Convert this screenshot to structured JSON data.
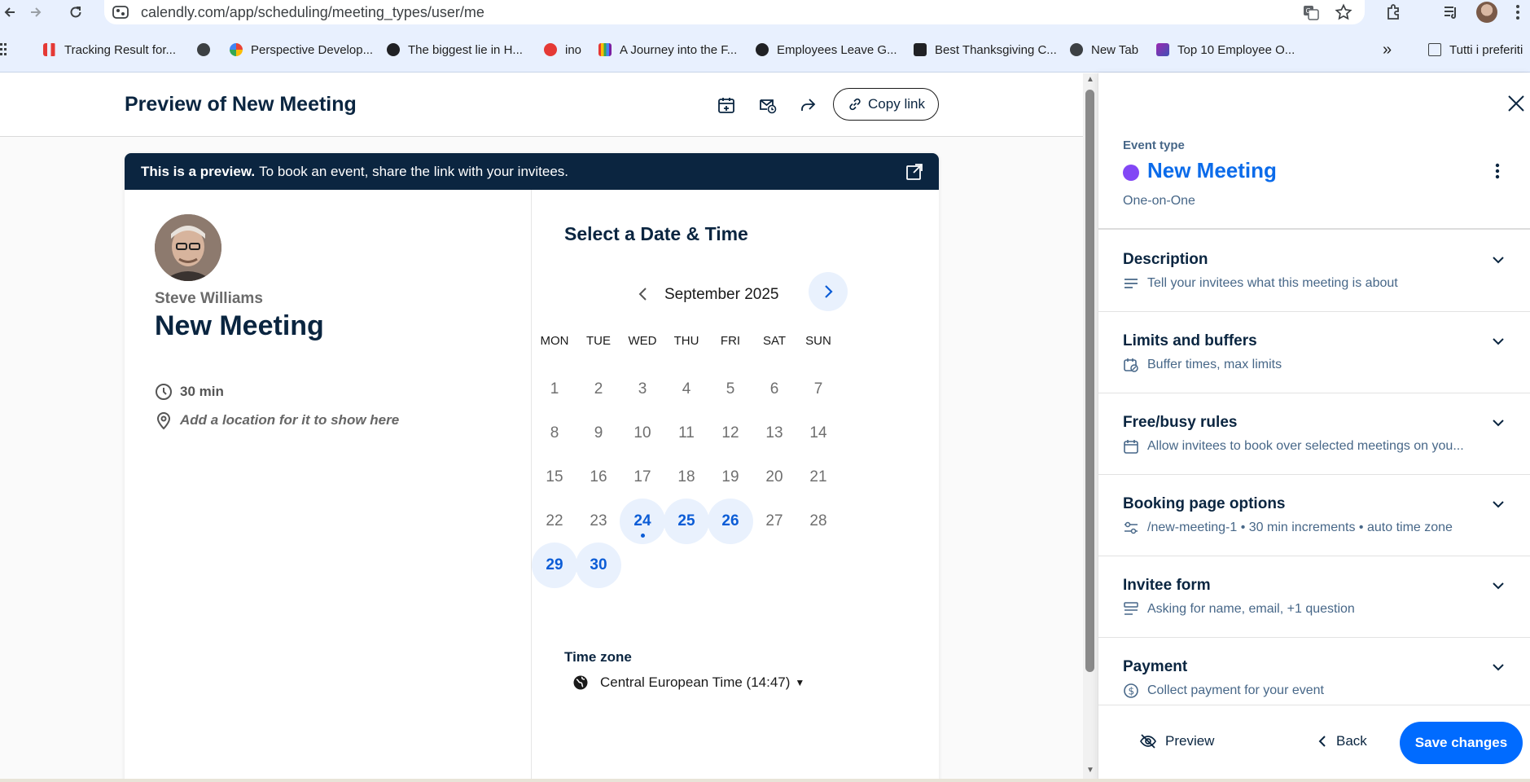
{
  "browser": {
    "url": "calendly.com/app/scheduling/meeting_types/user/me",
    "bookmarks": [
      {
        "label": "Tracking Result for...",
        "color": "#e53935"
      },
      {
        "label": "",
        "color": "#202124"
      },
      {
        "label": "Perspective Develop...",
        "color": "#4285f4"
      },
      {
        "label": "The biggest lie in H...",
        "color": "#202124"
      },
      {
        "label": "ino",
        "color": "#e53935"
      },
      {
        "label": "A Journey into the F...",
        "color": "#7b1fa2"
      },
      {
        "label": "Employees Leave G...",
        "color": "#202124"
      },
      {
        "label": "Best Thanksgiving C...",
        "color": "#202124"
      },
      {
        "label": "New Tab",
        "color": "#202124"
      },
      {
        "label": "Top 10 Employee O...",
        "color": "#9c27b0"
      }
    ],
    "overflow": "»",
    "all_bookmarks": "Tutti i preferiti"
  },
  "header": {
    "title": "Preview of New Meeting",
    "copy_link": "Copy link"
  },
  "preview": {
    "banner_bold": "This is a preview.",
    "banner_text": "To book an event, share the link with your invitees.",
    "host_name": "Steve Williams",
    "event_name": "New Meeting",
    "duration": "30 min",
    "location": "Add a location for it to show here",
    "calendar_title": "Select a Date & Time",
    "month": "September 2025",
    "weekdays": [
      "MON",
      "TUE",
      "WED",
      "THU",
      "FRI",
      "SAT",
      "SUN"
    ],
    "days": [
      {
        "n": "1"
      },
      {
        "n": "2"
      },
      {
        "n": "3"
      },
      {
        "n": "4"
      },
      {
        "n": "5"
      },
      {
        "n": "6"
      },
      {
        "n": "7"
      },
      {
        "n": "8"
      },
      {
        "n": "9"
      },
      {
        "n": "10"
      },
      {
        "n": "11"
      },
      {
        "n": "12"
      },
      {
        "n": "13"
      },
      {
        "n": "14"
      },
      {
        "n": "15"
      },
      {
        "n": "16"
      },
      {
        "n": "17"
      },
      {
        "n": "18"
      },
      {
        "n": "19"
      },
      {
        "n": "20"
      },
      {
        "n": "21"
      },
      {
        "n": "22"
      },
      {
        "n": "23"
      },
      {
        "n": "24",
        "avail": true,
        "today": true
      },
      {
        "n": "25",
        "avail": true
      },
      {
        "n": "26",
        "avail": true
      },
      {
        "n": "27"
      },
      {
        "n": "28"
      },
      {
        "n": "29",
        "avail": true
      },
      {
        "n": "30",
        "avail": true
      }
    ],
    "timezone_label": "Time zone",
    "timezone": "Central European Time (14:47)"
  },
  "panel": {
    "event_type_label": "Event type",
    "event_name": "New Meeting",
    "event_kind": "One-on-One",
    "accent": "#8247f5",
    "sections": [
      {
        "title": "Description",
        "sub": "Tell your invitees what this meeting is about",
        "icon": "text-lines-icon"
      },
      {
        "title": "Limits and buffers",
        "sub": "Buffer times, max limits",
        "icon": "calendar-clock-icon"
      },
      {
        "title": "Free/busy rules",
        "sub": "Allow invitees to book over selected meetings on you...",
        "icon": "calendar-icon"
      },
      {
        "title": "Booking page options",
        "sub": "/new-meeting-1 • 30 min increments • auto time zone",
        "icon": "sliders-icon"
      },
      {
        "title": "Invitee form",
        "sub": "Asking for name, email, +1 question",
        "icon": "form-icon"
      },
      {
        "title": "Payment",
        "sub": "Collect payment for your event",
        "icon": "dollar-icon"
      }
    ],
    "preview_btn": "Preview",
    "back_btn": "Back",
    "save_btn": "Save changes"
  }
}
